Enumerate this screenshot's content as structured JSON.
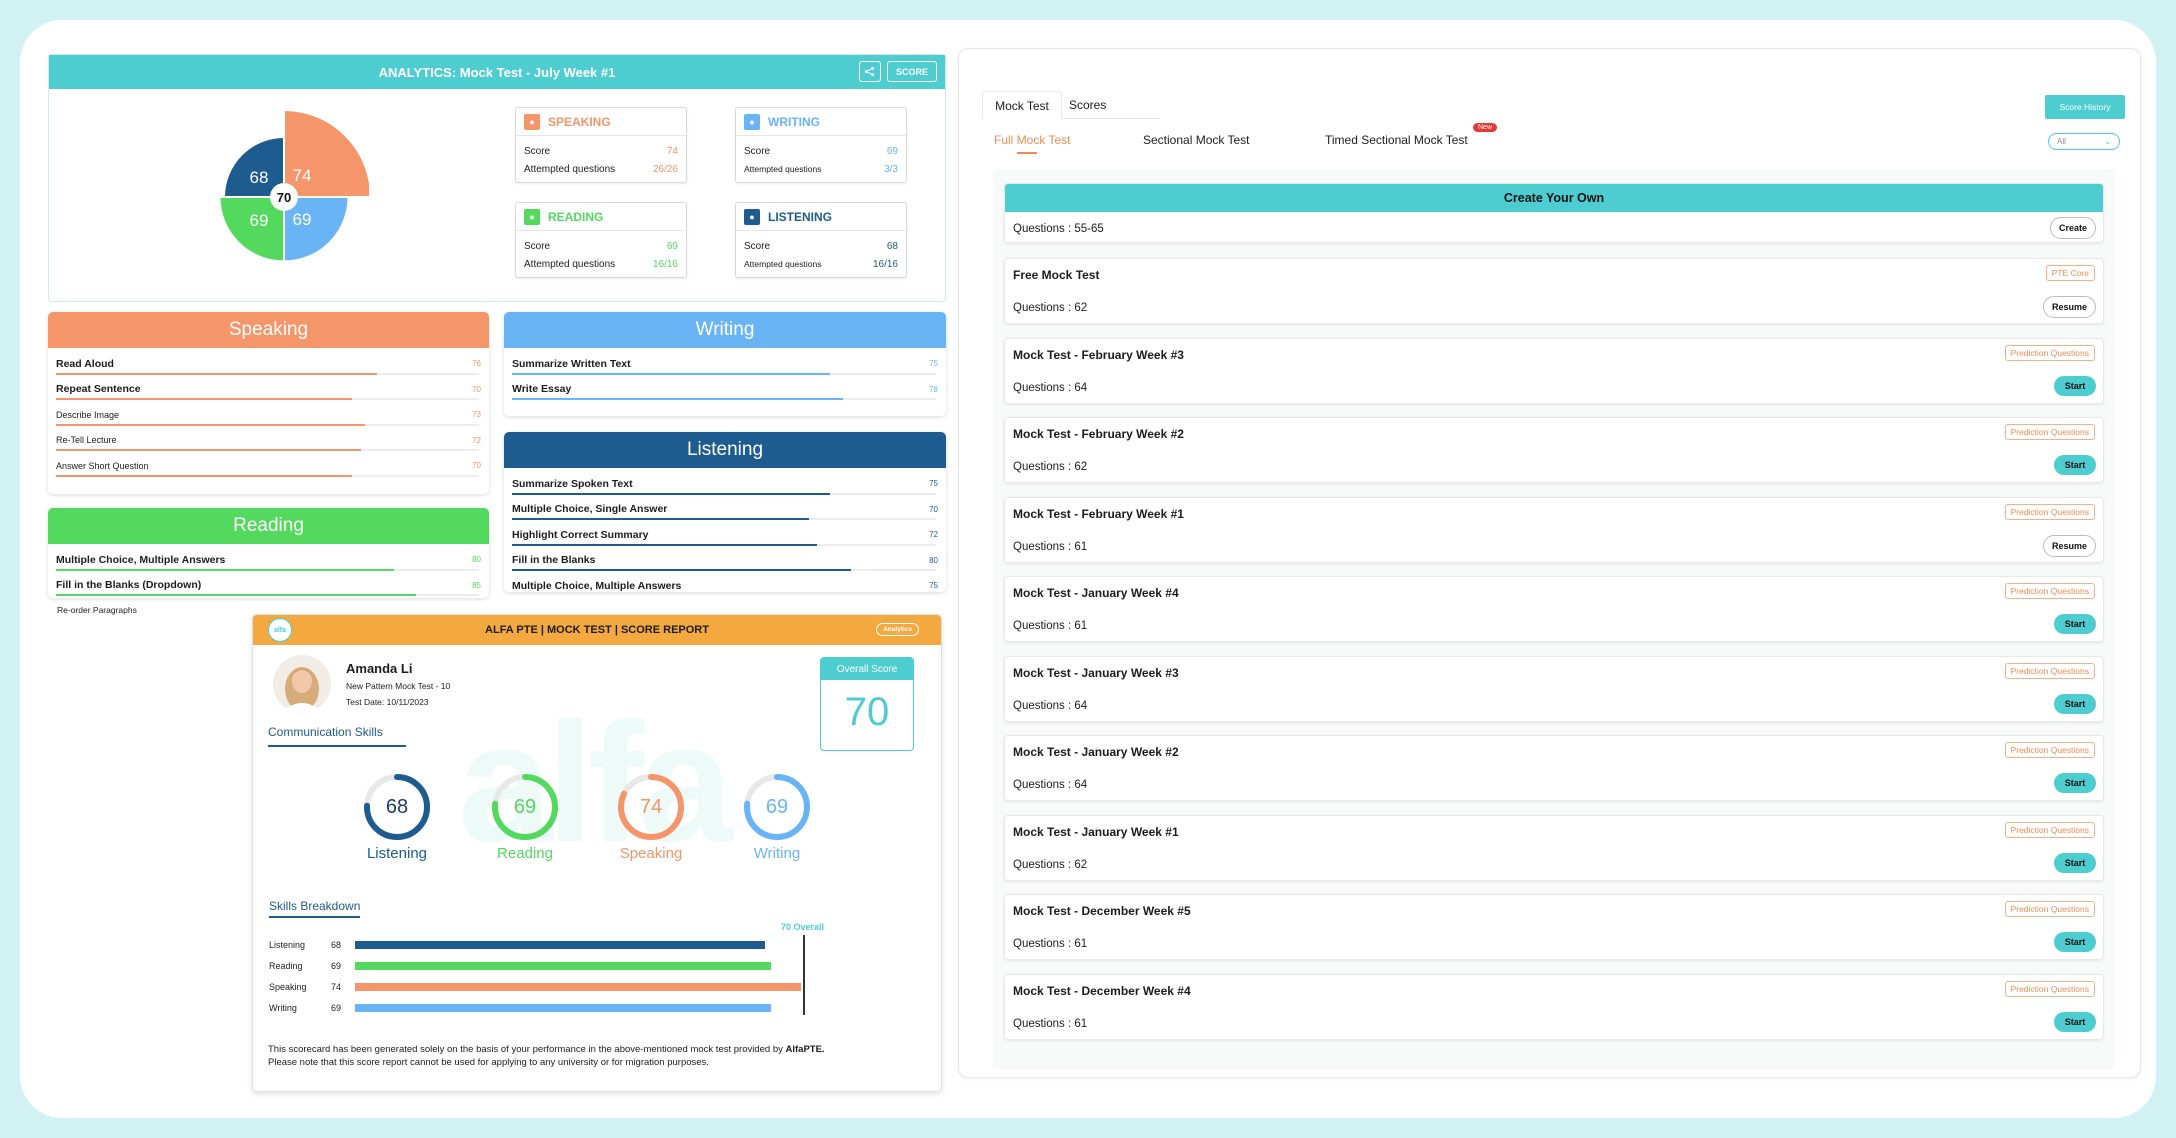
{
  "colors": {
    "teal": "#4ecdd1",
    "orange": "#f4956a",
    "blue_light": "#69b4f5",
    "blue_dark": "#1e5b8e",
    "green": "#52d95e",
    "report_orange": "#f4a940"
  },
  "analytics": {
    "title": "ANALYTICS: Mock Test - July Week #1",
    "share_icon": "share-icon",
    "score_btn": "SCORE",
    "overall": "70",
    "pie": [
      {
        "name": "Speaking",
        "value": 74,
        "label": "74",
        "color": "#f4956a"
      },
      {
        "name": "Writing",
        "value": 69,
        "label": "69",
        "color": "#69b4f5"
      },
      {
        "name": "Reading",
        "value": 69,
        "label": "69",
        "color": "#52d95e"
      },
      {
        "name": "Listening",
        "value": 68,
        "label": "68",
        "color": "#1e5b8e"
      }
    ],
    "cards": [
      {
        "title": "SPEAKING",
        "icon": "microphone-icon",
        "score_label": "Score",
        "score": "74",
        "att_label": "Attempted questions",
        "att": "26/26",
        "color": "#f4956a"
      },
      {
        "title": "WRITING",
        "icon": "pen-icon",
        "score_label": "Score",
        "score": "69",
        "att_label": "Attempted questions",
        "att": "3/3",
        "color": "#69b4f5"
      },
      {
        "title": "READING",
        "icon": "book-icon",
        "score_label": "Score",
        "score": "69",
        "att_label": "Attempted questions",
        "att": "16/16",
        "color": "#52d95e"
      },
      {
        "title": "LISTENING",
        "icon": "headphones-icon",
        "score_label": "Score",
        "score": "68",
        "att_label": "Attempted questions",
        "att": "16/16",
        "color": "#1e5b8e"
      }
    ]
  },
  "speaking": {
    "title": "Speaking",
    "rows": [
      {
        "label": "Read Aloud",
        "value": 76
      },
      {
        "label": "Repeat Sentence",
        "value": 70
      },
      {
        "label": "Describe Image",
        "value": 73
      },
      {
        "label": "Re-Tell Lecture",
        "value": 72
      },
      {
        "label": "Answer Short Question",
        "value": 70
      }
    ]
  },
  "writing": {
    "title": "Writing",
    "rows": [
      {
        "label": "Summarize Written Text",
        "value": 75
      },
      {
        "label": "Write Essay",
        "value": 78
      }
    ]
  },
  "listening": {
    "title": "Listening",
    "rows": [
      {
        "label": "Summarize Spoken Text",
        "value": 75
      },
      {
        "label": "Multiple Choice, Single Answer",
        "value": 70
      },
      {
        "label": "Highlight Correct Summary",
        "value": 72
      },
      {
        "label": "Fill in the Blanks",
        "value": 80
      },
      {
        "label": "Multiple Choice, Multiple Answers",
        "value": 75
      }
    ]
  },
  "reading": {
    "title": "Reading",
    "rows": [
      {
        "label": "Multiple Choice, Multiple Answers",
        "value": 80
      },
      {
        "label": "Fill in the Blanks (Dropdown)",
        "value": 85
      }
    ],
    "extra_label": "Re-order Paragraphs"
  },
  "report": {
    "logo": "alfa",
    "title": "ALFA PTE | MOCK TEST | SCORE REPORT",
    "badge": "Analytics",
    "name": "Amanda Li",
    "test": "New Pattern Mock Test - 10",
    "date": "Test Date: 10/11/2023",
    "overall_label": "Overall Score",
    "overall": "70",
    "comm_title": "Communication Skills",
    "rings": [
      {
        "label": "Listening",
        "value": 68,
        "color": "#1e5b8e"
      },
      {
        "label": "Reading",
        "value": 69,
        "color": "#52d95e"
      },
      {
        "label": "Speaking",
        "value": 74,
        "color": "#f4956a"
      },
      {
        "label": "Writing",
        "value": 69,
        "color": "#69b4f5"
      }
    ],
    "breakdown_title": "Skills Breakdown",
    "overall_marker": "70 Overall",
    "footer1": "This scorecard has been generated solely on the basis of your performance in the above-mentioned mock test provided by ",
    "footer_brand": "AlfaPTE.",
    "footer2": "Please note that this score report cannot be used for applying to any university or for migration purposes."
  },
  "mock": {
    "tabs": [
      "Mock Test",
      "Scores"
    ],
    "score_history": "Score History",
    "subtabs": [
      "Full Mock Test",
      "Sectional Mock Test",
      "Timed Sectional Mock Test"
    ],
    "new_badge": "New",
    "filter": "All",
    "create_title": "Create Your Own",
    "create_q": "Questions : 55-65",
    "create_btn": "Create",
    "items": [
      {
        "name": "Free Mock Test",
        "q": "Questions : 62",
        "tag": "PTE Core",
        "btn": "Resume"
      },
      {
        "name": "Mock Test - February Week #3",
        "q": "Questions : 64",
        "tag": "Prediction Questions",
        "btn": "Start"
      },
      {
        "name": "Mock Test - February Week #2",
        "q": "Questions : 62",
        "tag": "Prediction Questions",
        "btn": "Start"
      },
      {
        "name": "Mock Test - February Week #1",
        "q": "Questions : 61",
        "tag": "Prediction Questions",
        "btn": "Resume"
      },
      {
        "name": "Mock Test - January Week #4",
        "q": "Questions : 61",
        "tag": "Prediction Questions",
        "btn": "Start"
      },
      {
        "name": "Mock Test - January Week #3",
        "q": "Questions : 64",
        "tag": "Prediction Questions",
        "btn": "Start"
      },
      {
        "name": "Mock Test - January Week #2",
        "q": "Questions : 64",
        "tag": "Prediction Questions",
        "btn": "Start"
      },
      {
        "name": "Mock Test - January Week #1",
        "q": "Questions : 62",
        "tag": "Prediction Questions",
        "btn": "Start"
      },
      {
        "name": "Mock Test - December Week #5",
        "q": "Questions : 61",
        "tag": "Prediction Questions",
        "btn": "Start"
      },
      {
        "name": "Mock Test - December Week #4",
        "q": "Questions : 61",
        "tag": "Prediction Questions",
        "btn": "Start"
      }
    ]
  }
}
